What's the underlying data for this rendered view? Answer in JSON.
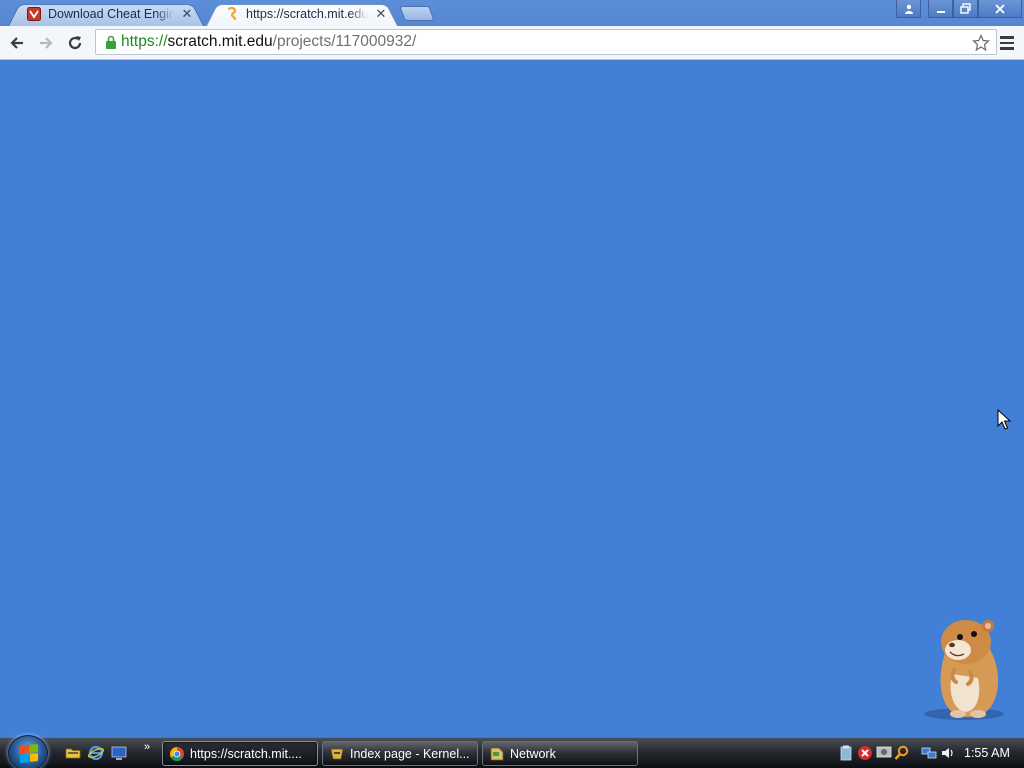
{
  "browser": {
    "tabs": [
      {
        "title": "Download Cheat Engine",
        "active": false,
        "favicon": "cheat-engine-icon"
      },
      {
        "title": "https://scratch.mit.edu/p",
        "active": true,
        "favicon": "scratch-icon"
      }
    ],
    "omnibox": {
      "scheme": "https://",
      "host": "scratch.mit.edu",
      "path": "/projects/117000932/"
    },
    "window_controls": [
      "user-icon",
      "minimize-icon",
      "restore-icon",
      "close-icon"
    ]
  },
  "page": {
    "background": "#4280d8"
  },
  "taskbar": {
    "buttons": [
      {
        "label": "https://scratch.mit....",
        "icon": "chrome-icon",
        "active": true
      },
      {
        "label": "Index page - Kernel...",
        "icon": "kernel-icon",
        "active": false
      },
      {
        "label": "Network",
        "icon": "network-icon",
        "active": false
      }
    ],
    "quick_launch": [
      "folder-icon",
      "ie-icon",
      "show-desktop-icon"
    ],
    "tray_icons": [
      "clipboard-icon",
      "shield-alert-icon",
      "monitor-icon",
      "search-icon",
      "network-tray-icon",
      "volume-icon"
    ],
    "clock": "1:55 AM"
  },
  "colors": {
    "page_blue": "#4280d8",
    "url_green": "#1c8a1c"
  }
}
